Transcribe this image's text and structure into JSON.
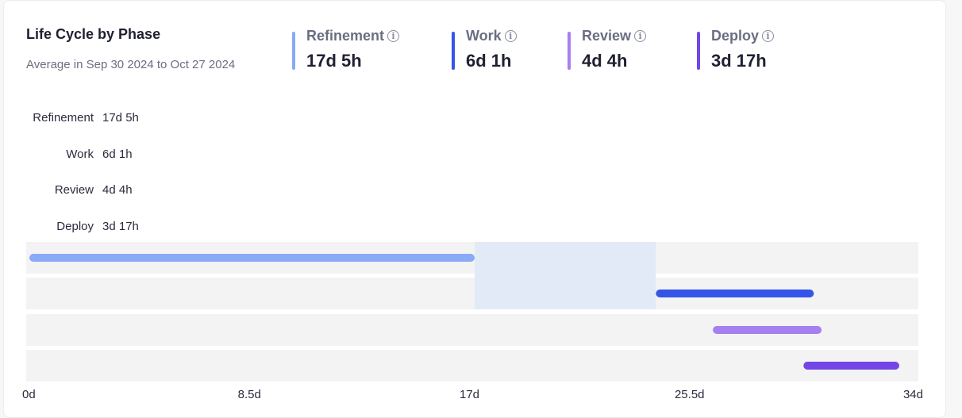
{
  "header": {
    "title": "Life Cycle by Phase",
    "subtitle": "Average in Sep 30 2024 to Oct 27 2024"
  },
  "stats": [
    {
      "label": "Refinement",
      "value": "17d 5h",
      "color": "#8aaaf7"
    },
    {
      "label": "Work",
      "value": "6d 1h",
      "color": "#3555e8"
    },
    {
      "label": "Review",
      "value": "4d 4h",
      "color": "#a67ff2"
    },
    {
      "label": "Deploy",
      "value": "3d 17h",
      "color": "#7445e6"
    }
  ],
  "info_icon_glyph": "i",
  "rows": [
    {
      "label": "Refinement",
      "value": "17d 5h"
    },
    {
      "label": "Work",
      "value": "6d 1h"
    },
    {
      "label": "Review",
      "value": "4d 4h"
    },
    {
      "label": "Deploy",
      "value": "3d 17h"
    }
  ],
  "chart_data": {
    "type": "bar",
    "orientation": "horizontal-range",
    "x_unit": "days",
    "xlim": [
      0,
      34
    ],
    "x_ticks": [
      0,
      8.5,
      17,
      25.5,
      34
    ],
    "x_tick_labels": [
      "0d",
      "8.5d",
      "17d",
      "25.5d",
      "34d"
    ],
    "series": [
      {
        "name": "Refinement",
        "start": 0,
        "end": 17.2,
        "color": "#8aaaf7"
      },
      {
        "name": "Work",
        "start": 24.2,
        "end": 30.3,
        "color": "#3555e8"
      },
      {
        "name": "Review",
        "start": 26.4,
        "end": 30.6,
        "color": "#a67ff2"
      },
      {
        "name": "Deploy",
        "start": 29.9,
        "end": 33.6,
        "color": "#7445e6"
      }
    ],
    "highlight_range": [
      17.2,
      24.2
    ],
    "highlight_color": "#e3eaf7",
    "track_color": "#f3f3f4"
  }
}
